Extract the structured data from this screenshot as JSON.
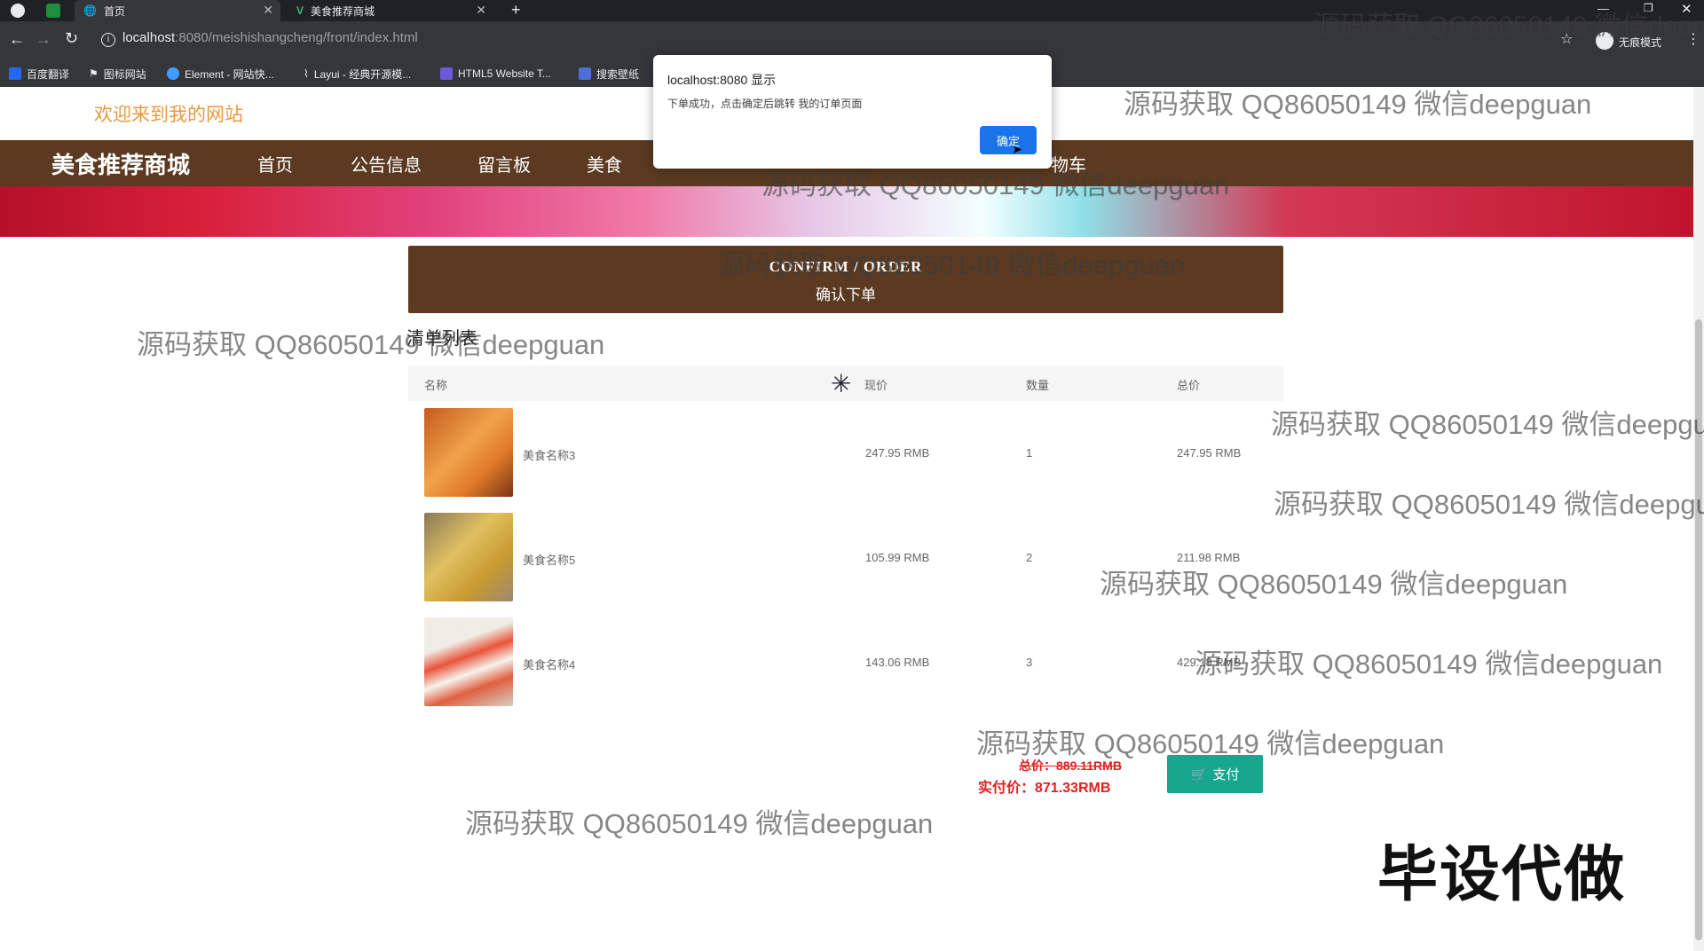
{
  "browser": {
    "tabs": [
      {
        "title": "首页",
        "active": true
      },
      {
        "title": "美食推荐商城",
        "active": false
      }
    ],
    "url_host": "localhost",
    "url_path": ":8080/meishishangcheng/front/index.html",
    "incognito_label": "无痕模式",
    "bookmarks": [
      "百度翻译",
      "图标网站",
      "Element - 网站快...",
      "Layui - 经典开源模...",
      "HTML5 Website T...",
      "搜索壁纸"
    ]
  },
  "site": {
    "welcome": "欢迎来到我的网站",
    "brand": "美食推荐商城",
    "nav": [
      "首页",
      "公告信息",
      "留言板",
      "美食",
      "物车"
    ],
    "confirm_en": "CONFIRM / ORDER",
    "confirm_zh": "确认下单",
    "list_title": "清单列表"
  },
  "table": {
    "headers": {
      "name": "名称",
      "price": "现价",
      "qty": "数量",
      "total": "总价"
    },
    "rows": [
      {
        "name": "美食名称3",
        "price": "247.95 RMB",
        "qty": "1",
        "total": "247.95 RMB"
      },
      {
        "name": "美食名称5",
        "price": "105.99 RMB",
        "qty": "2",
        "total": "211.98 RMB"
      },
      {
        "name": "美食名称4",
        "price": "143.06 RMB",
        "qty": "3",
        "total": "429.18 RMB"
      }
    ]
  },
  "summary": {
    "original_total": "总价：889.11RMB",
    "actual_total": "实付价：871.33RMB",
    "pay_label": "支付"
  },
  "alert": {
    "title": "localhost:8080 显示",
    "message": "下单成功，点击确定后跳转 我的订单页面",
    "ok_label": "确定"
  },
  "watermark_text": "源码获取 QQ86050149 微信deepguan",
  "stamp_text": "毕设代做",
  "colors": {
    "nav_brown": "#5b3a21",
    "welcome_orange": "#e89a3c",
    "pay_teal": "#18a68e",
    "price_red": "#e02020"
  }
}
